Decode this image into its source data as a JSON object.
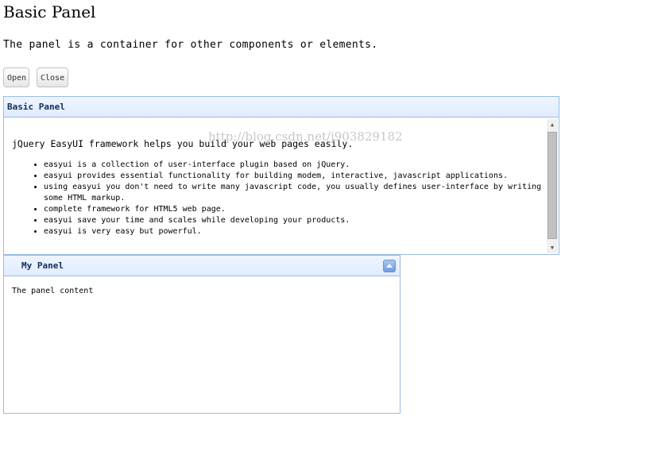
{
  "page": {
    "title": "Basic Panel",
    "intro": "The panel is a container for other components or elements."
  },
  "toolbar": {
    "open_label": "Open",
    "close_label": "Close"
  },
  "basic_panel": {
    "title": "Basic Panel",
    "paragraph": "jQuery EasyUI framework helps you build your web pages easily.",
    "items": [
      "easyui is a collection of user-interface plugin based on jQuery.",
      "easyui provides essential functionality for building modem, interactive, javascript applications.",
      "using easyui you don't need to write many javascript code, you usually defines user-interface by writing some HTML markup.",
      "complete framework for HTML5 web page.",
      "easyui save your time and scales while developing your products.",
      "easyui is very easy but powerful."
    ],
    "scroll_up_icon": "triangle-up-icon",
    "scroll_down_icon": "triangle-down-icon"
  },
  "watermark": "http://blog.csdn.net/j903829182",
  "my_panel": {
    "title": "My Panel",
    "content": "The panel content",
    "collapse_icon": "collapse-up-icon"
  },
  "colors": {
    "panel_border": "#99bbe8",
    "header_top": "#eff5ff",
    "header_bottom": "#e0ecff",
    "title_text": "#0e2d5f"
  }
}
